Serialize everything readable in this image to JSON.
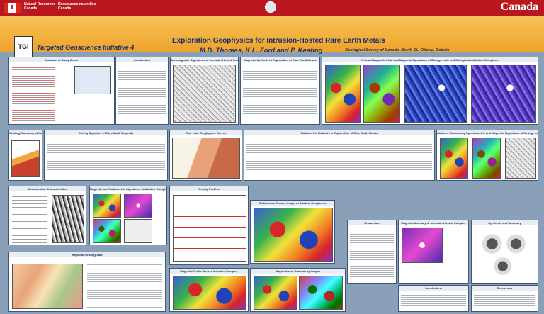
{
  "header": {
    "gov_en_1": "Natural Resources",
    "gov_en_2": "Canada",
    "gov_fr_1": "Ressources naturelles",
    "gov_fr_2": "Canada",
    "wordmark": "Canada"
  },
  "banner": {
    "logo_text": "TGI",
    "program": "Targeted Geoscience Initiative 4",
    "title": "Exploration Geophysics for Intrusion-Hosted Rare Earth Metals",
    "authors": "M.D. Thomas, K.L. Ford and P. Keating",
    "affiliation": "— Geological Survey of Canada, Booth St., Ottawa, Ontario"
  },
  "panels": {
    "introduction": "Introduction",
    "geology_intro": "Geology Summary of Intrusion-Hosted Rare Earth Deposits",
    "magnetic_map": "Aeromagnetic Signatures of Intrusion-Hosted Complexes",
    "magnetic_methods": "Magnetic Methods in Exploration of Rare Earth Metals",
    "residual": "Residual Magnetic Field and Magnetic Signatures of Strange Lake and Misery Lake Alkaline Complexes",
    "location": "Location of Study Areas",
    "gravity": "Gravity Signature of Rare Earth Deposits",
    "thor_lake": "Thor Lake Geophysics Survey",
    "radiometric": "Radiometric Methods in Exploration of Rare Earth Metals",
    "ternary": "Airborne Gamma-ray Spectrometric and Magnetic Signatures of Strange Lake and Misery Lake Alkaline Complexes",
    "chemistry": "Geochemical Characteristics",
    "gravity_profiles": "Gravity Profiles",
    "radiometric_map": "Radiometric Ternary Image of Alkaline Complexes",
    "discussion": "Discussion",
    "crater": "Magnetic Anomaly of Intrusion-Hosted Complex",
    "synthesis": "Synthesis and Summary",
    "magnetic_radiometric": "Magnetic and Radiometric Signatures of Alkaline Complexes",
    "regional": "Regional Geology Map",
    "mag_profile": "Magnetic Profile Across Intrusive Complex",
    "color_maps": "Magnetic and Gamma-ray Images",
    "conclusions": "Conclusions",
    "references": "References"
  }
}
